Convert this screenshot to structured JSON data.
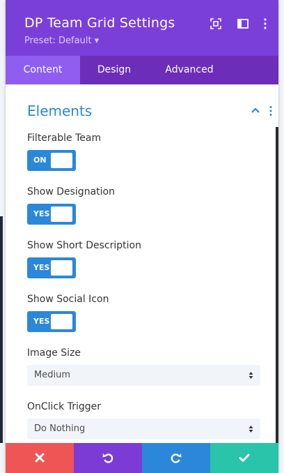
{
  "header": {
    "title": "DP Team Grid Settings",
    "preset": "Preset: Default ▾",
    "icons": [
      "focus-icon",
      "split-view-icon",
      "more-vertical-icon"
    ]
  },
  "tabs": [
    {
      "label": "Content",
      "active": true
    },
    {
      "label": "Design",
      "active": false
    },
    {
      "label": "Advanced",
      "active": false
    }
  ],
  "section": {
    "title": "Elements"
  },
  "fields": {
    "filterable_team": {
      "label": "Filterable Team",
      "toggle": "ON"
    },
    "show_designation": {
      "label": "Show Designation",
      "toggle": "YES"
    },
    "show_short_description": {
      "label": "Show Short Description",
      "toggle": "YES"
    },
    "show_social_icon": {
      "label": "Show Social Icon",
      "toggle": "YES"
    },
    "image_size": {
      "label": "Image Size",
      "value": "Medium"
    },
    "onclick_trigger": {
      "label": "OnClick Trigger",
      "value": "Do Nothing"
    }
  },
  "footer": {
    "buttons": [
      "close-icon",
      "undo-icon",
      "redo-icon",
      "check-icon"
    ]
  },
  "colors": {
    "header": "#7b3fd9",
    "tabs": "#6c2eb9",
    "tab_active": "#8f5ef0",
    "accent_blue": "#2b87da",
    "cancel": "#ef5555",
    "undo": "#7d3bd5",
    "redo": "#2b87da",
    "save": "#29c4a9"
  }
}
